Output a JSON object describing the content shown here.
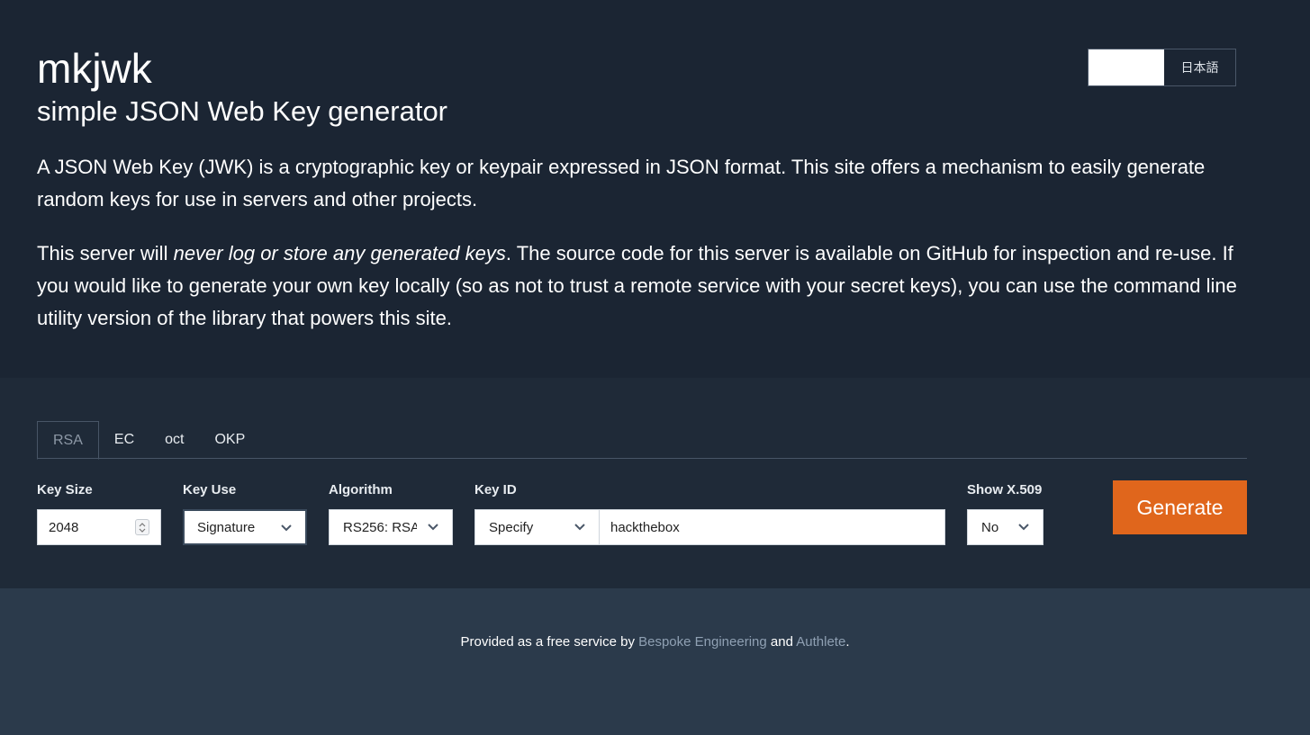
{
  "header": {
    "title": "mkjwk",
    "subtitle": "simple JSON Web Key generator",
    "language": {
      "english_label": "",
      "japanese_label": "日本語"
    }
  },
  "intro": {
    "p1": "A JSON Web Key (JWK) is a cryptographic key or keypair expressed in JSON format. This site offers a mechanism to easily generate random keys for use in servers and other projects.",
    "p2_start": "This server will ",
    "p2_emphasis": "never log or store any generated keys",
    "p2_end": ". The source code for this server is available on GitHub for inspection and re-use. If you would like to generate your own key locally (so as not to trust a remote service with your secret keys), you can use the command line utility version of the library that powers this site."
  },
  "tabs": [
    {
      "label": "RSA",
      "active": true
    },
    {
      "label": "EC",
      "active": false
    },
    {
      "label": "oct",
      "active": false
    },
    {
      "label": "OKP",
      "active": false
    }
  ],
  "form": {
    "key_size": {
      "label": "Key Size",
      "value": "2048"
    },
    "key_use": {
      "label": "Key Use",
      "value": "Signature"
    },
    "algorithm": {
      "label": "Algorithm",
      "value": "RS256: RSA"
    },
    "key_id": {
      "label": "Key ID",
      "mode": "Specify",
      "value": "hackthebox"
    },
    "show_x509": {
      "label": "Show X.509",
      "value": "No"
    },
    "generate_label": "Generate"
  },
  "footer": {
    "prefix": "Provided as a free service by ",
    "link1": "Bespoke Engineering",
    "middle": " and ",
    "link2": "Authlete",
    "suffix": "."
  },
  "colors": {
    "hero_bg": "#1b2533",
    "tool_bg": "#1f2a38",
    "footer_bg": "#2b3a4b",
    "accent": "#e0661c",
    "link": "#8fa0b3"
  }
}
